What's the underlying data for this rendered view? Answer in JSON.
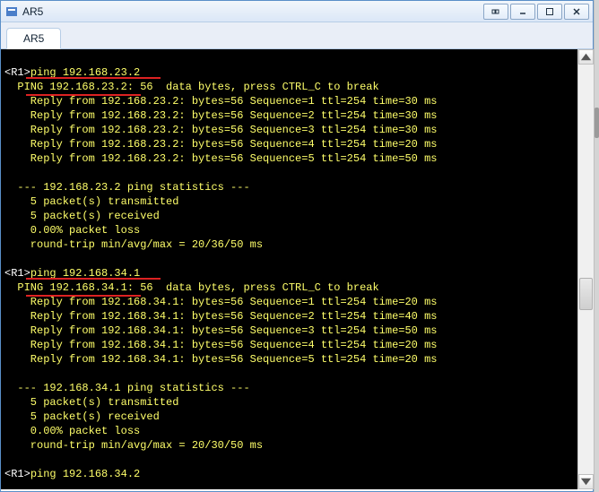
{
  "window": {
    "title": "AR5"
  },
  "tabs": [
    {
      "label": "AR5"
    }
  ],
  "terminal": {
    "cmd1": {
      "prompt": "<R1>",
      "command": "ping 192.168.23.2"
    },
    "ping1": {
      "header": "  PING 192.168.23.2: 56  data bytes, press CTRL_C to break",
      "replies": [
        "    Reply from 192.168.23.2: bytes=56 Sequence=1 ttl=254 time=30 ms",
        "    Reply from 192.168.23.2: bytes=56 Sequence=2 ttl=254 time=30 ms",
        "    Reply from 192.168.23.2: bytes=56 Sequence=3 ttl=254 time=30 ms",
        "    Reply from 192.168.23.2: bytes=56 Sequence=4 ttl=254 time=20 ms",
        "    Reply from 192.168.23.2: bytes=56 Sequence=5 ttl=254 time=50 ms"
      ],
      "stats_header": "  --- 192.168.23.2 ping statistics ---",
      "stats": [
        "    5 packet(s) transmitted",
        "    5 packet(s) received",
        "    0.00% packet loss",
        "    round-trip min/avg/max = 20/36/50 ms"
      ]
    },
    "cmd2": {
      "prompt": "<R1>",
      "command": "ping 192.168.34.1"
    },
    "ping2": {
      "header": "  PING 192.168.34.1: 56  data bytes, press CTRL_C to break",
      "replies": [
        "    Reply from 192.168.34.1: bytes=56 Sequence=1 ttl=254 time=20 ms",
        "    Reply from 192.168.34.1: bytes=56 Sequence=2 ttl=254 time=40 ms",
        "    Reply from 192.168.34.1: bytes=56 Sequence=3 ttl=254 time=50 ms",
        "    Reply from 192.168.34.1: bytes=56 Sequence=4 ttl=254 time=20 ms",
        "    Reply from 192.168.34.1: bytes=56 Sequence=5 ttl=254 time=20 ms"
      ],
      "stats_header": "  --- 192.168.34.1 ping statistics ---",
      "stats": [
        "    5 packet(s) transmitted",
        "    5 packet(s) received",
        "    0.00% packet loss",
        "    round-trip min/avg/max = 20/30/50 ms"
      ]
    },
    "cmd3": {
      "prompt": "<R1>",
      "command": "ping 192.168.34.2"
    }
  }
}
